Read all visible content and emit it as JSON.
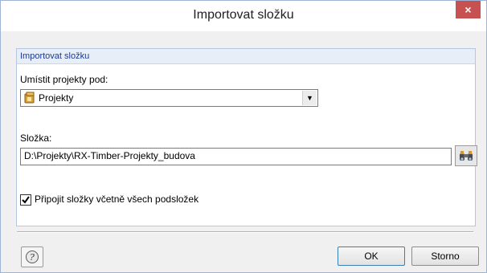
{
  "window": {
    "title": "Importovat složku",
    "close_label": "×"
  },
  "group": {
    "header": "Importovat složku",
    "place_label": "Umístit projekty pod:",
    "place_value": "Projekty",
    "folder_label": "Složka:",
    "folder_value": "D:\\Projekty\\RX-Timber-Projekty_budova",
    "checkbox_label": "Připojit složky včetně všech podsložek",
    "checkbox_checked": true
  },
  "buttons": {
    "ok": "OK",
    "cancel": "Storno"
  },
  "icons": {
    "project": "project-folder-icon",
    "browse": "binoculars-icon",
    "help": "help-icon",
    "dropdown": "chevron-down-icon"
  },
  "colors": {
    "accent": "#1b3a8f",
    "close": "#c75050"
  }
}
